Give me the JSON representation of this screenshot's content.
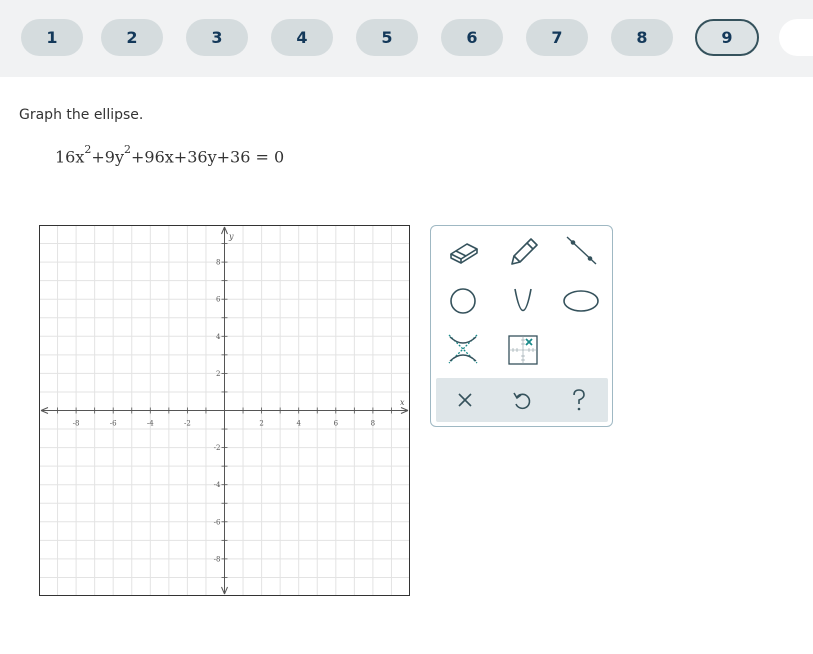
{
  "nav": {
    "questions": [
      {
        "label": "1"
      },
      {
        "label": "2"
      },
      {
        "label": "3"
      },
      {
        "label": "4"
      },
      {
        "label": "5"
      },
      {
        "label": "6"
      },
      {
        "label": "7"
      },
      {
        "label": "8"
      },
      {
        "label": "9",
        "current": true
      }
    ]
  },
  "problem": {
    "prompt": "Graph the ellipse.",
    "eq_part1": "16x",
    "eq_exp1": "2",
    "eq_part2": "+9y",
    "eq_exp2": "2",
    "eq_part3": "+96x+36y+36 = 0"
  },
  "graph": {
    "x_var": "x",
    "y_var": "y",
    "range": [
      -10,
      10
    ],
    "x_tick_labels": [
      "-8",
      "-6",
      "-4",
      "-2",
      "2",
      "4",
      "6",
      "8"
    ],
    "y_tick_labels": [
      "8",
      "6",
      "4",
      "2",
      "-2",
      "-4",
      "-6",
      "-8"
    ],
    "grid": true
  },
  "toolbox": {
    "tools": [
      "eraser-icon",
      "pencil-icon",
      "line-icon",
      "circle-icon",
      "parabola-icon",
      "ellipse-icon",
      "hyperbola-icon",
      "point-grid-icon"
    ],
    "actions": [
      "clear-icon",
      "undo-icon",
      "help-icon"
    ],
    "accent_color": "#1a8a8a",
    "icon_color": "#35525c"
  }
}
